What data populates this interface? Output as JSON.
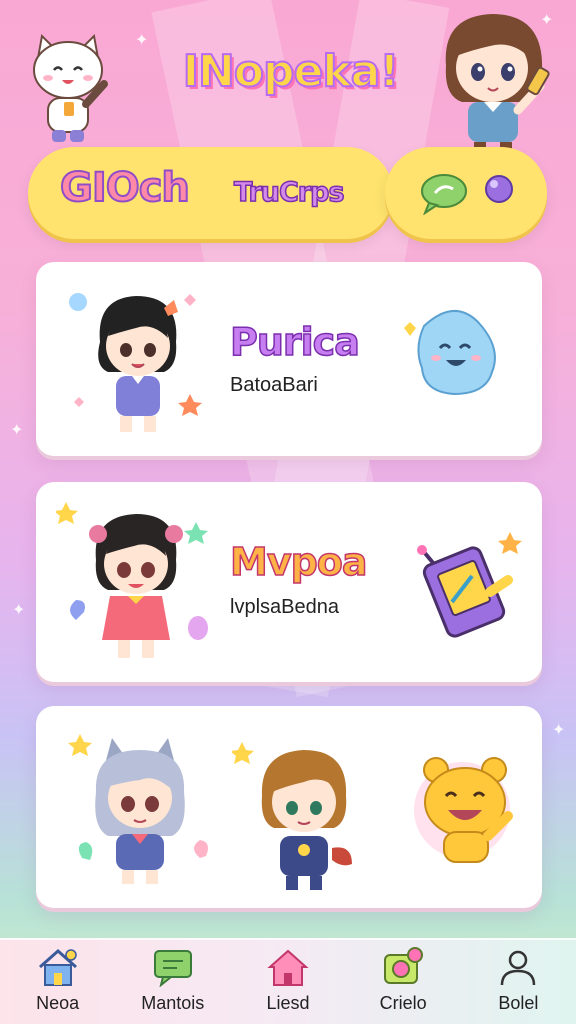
{
  "header": {
    "title": "INopeka!"
  },
  "tabs": {
    "primary_label": "GIOch",
    "secondary_label": "TruCrps",
    "icons": [
      "chat-bubble-icon",
      "purple-orb-icon"
    ]
  },
  "cards": [
    {
      "title": "Purica",
      "subtitle": "BatoaBari",
      "title_color": "#b46ee6"
    },
    {
      "title": "Mvpoa",
      "subtitle": "lvplsaBedna",
      "title_color": "#ff8a3d"
    },
    {
      "title": "",
      "subtitle": ""
    }
  ],
  "bottom_nav": {
    "items": [
      {
        "label": "Neoa",
        "icon": "house-icon"
      },
      {
        "label": "Mantois",
        "icon": "chat-icon"
      },
      {
        "label": "Liesd",
        "icon": "home-icon"
      },
      {
        "label": "Crielo",
        "icon": "camera-icon"
      },
      {
        "label": "Bolel",
        "icon": "profile-icon"
      }
    ]
  },
  "colors": {
    "accent_yellow": "#ffe36e",
    "accent_pink": "#ff73b6",
    "accent_purple": "#b66cf0"
  }
}
